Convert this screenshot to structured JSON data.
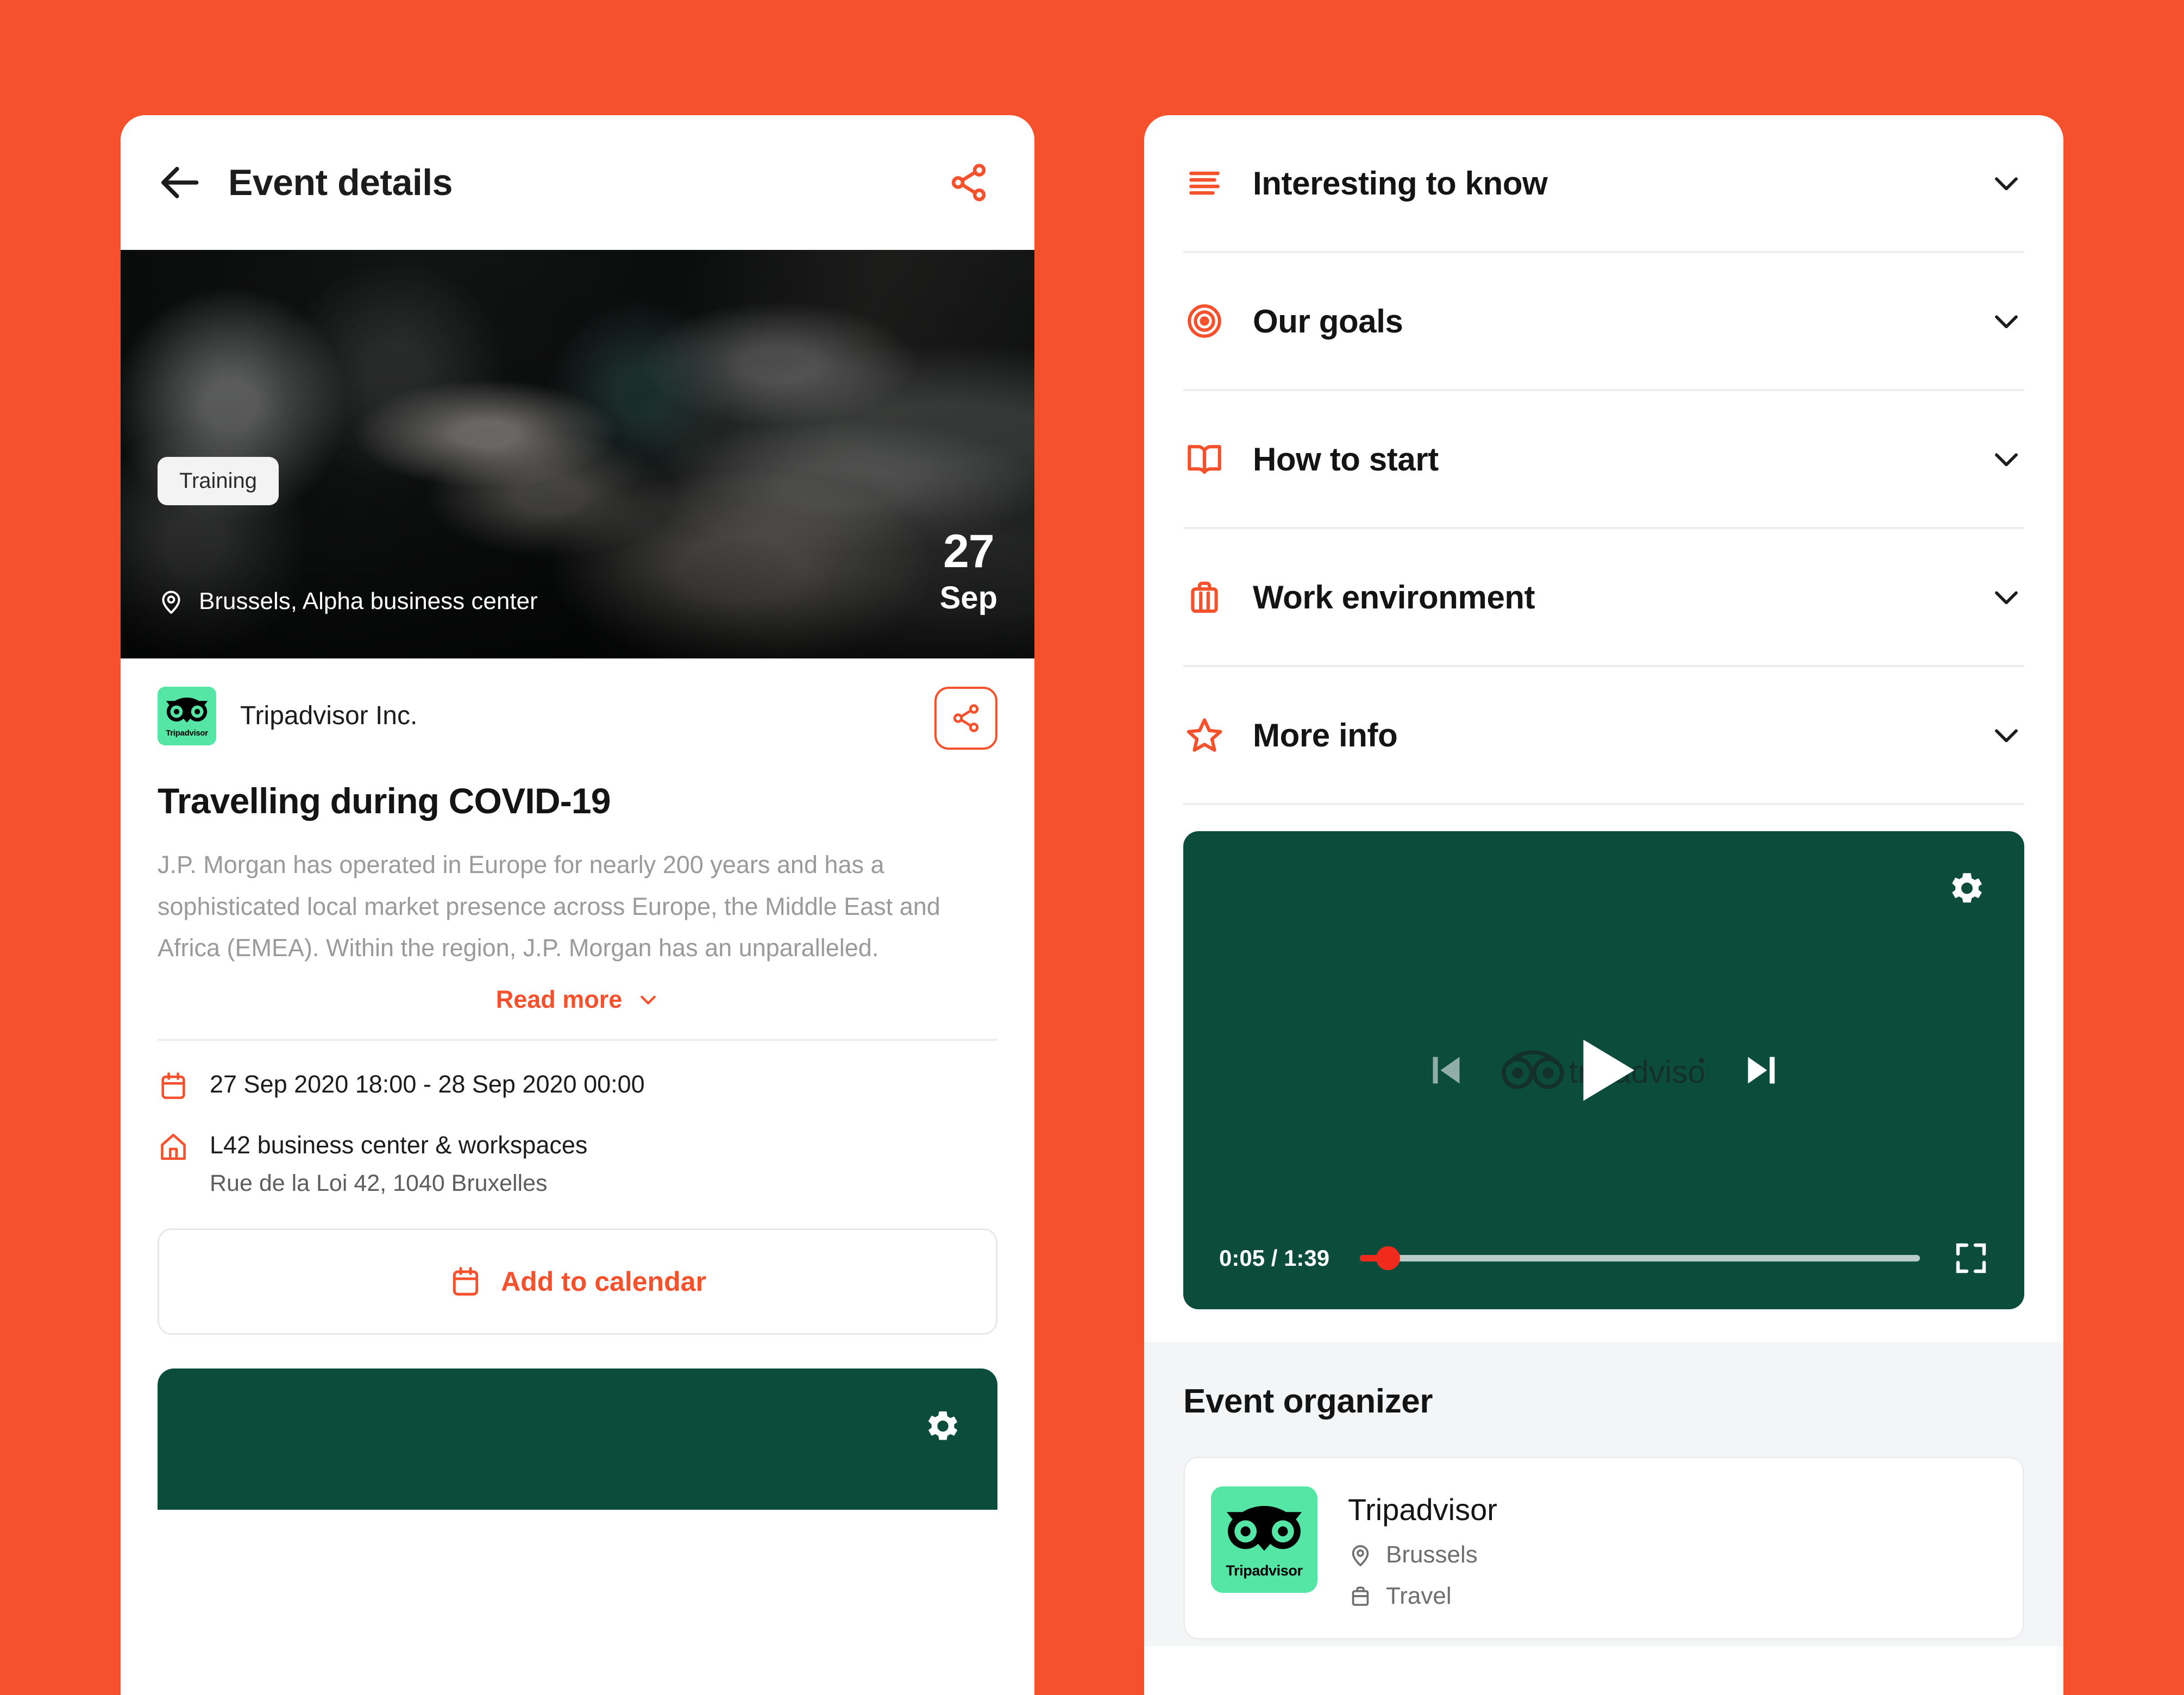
{
  "theme": {
    "accent": "#F4512C",
    "green_dark": "#0C4C3B",
    "tripadvisor_green": "#55E5A4",
    "progress_red": "#F02B1D"
  },
  "left_panel": {
    "header": {
      "back_icon": "arrow-left-icon",
      "title": "Event details",
      "share_icon": "share-icon"
    },
    "hero": {
      "badge": "Training",
      "location_icon": "map-pin-icon",
      "location": "Brussels, Alpha business center",
      "date_day": "27",
      "date_month": "Sep"
    },
    "organizer_row": {
      "logo_wordmark": "Tripadvisor",
      "name": "Tripadvisor Inc.",
      "share_icon": "share-icon"
    },
    "event": {
      "title": "Travelling during COVID-19",
      "description": "J.P. Morgan has operated in Europe for nearly 200 years and has a sophisticated local market presence across Europe, the Middle East and Africa (EMEA). Within the region, J.P. Morgan has an unparalleled.",
      "read_more_label": "Read more",
      "read_more_icon": "chevron-down-icon"
    },
    "meta": {
      "date_icon": "calendar-icon",
      "datetime": "27 Sep 2020 18:00 - 28 Sep 2020 00:00",
      "venue_icon": "home-icon",
      "venue_name": "L42 business center & workspaces",
      "venue_address": "Rue de la Loi 42, 1040 Bruxelles"
    },
    "add_to_calendar": {
      "icon": "calendar-icon",
      "label": "Add to calendar"
    },
    "video_preview": {
      "settings_icon": "gear-icon"
    }
  },
  "right_panel": {
    "accordion": [
      {
        "icon": "list-lines-icon",
        "label": "Interesting to know",
        "chevron": "chevron-down-icon",
        "expanded": false
      },
      {
        "icon": "target-icon",
        "label": "Our goals",
        "chevron": "chevron-down-icon",
        "expanded": false
      },
      {
        "icon": "open-book-icon",
        "label": "How to start",
        "chevron": "chevron-down-icon",
        "expanded": false
      },
      {
        "icon": "briefcase-icon",
        "label": "Work environment",
        "chevron": "chevron-down-icon",
        "expanded": false
      },
      {
        "icon": "star-icon",
        "label": "More info",
        "chevron": "chevron-down-icon",
        "expanded": false
      }
    ],
    "player": {
      "settings_icon": "gear-icon",
      "prev_icon": "skip-previous-icon",
      "play_icon": "play-icon",
      "next_icon": "skip-next-icon",
      "watermark": "tripadvisor",
      "current_time": "0:05",
      "total_time": "1:39",
      "time_display": "0:05 / 1:39",
      "progress_percent": 5,
      "fullscreen_icon": "fullscreen-icon"
    },
    "organizer_section": {
      "heading": "Event organizer",
      "card": {
        "logo_wordmark": "Tripadvisor",
        "name": "Tripadvisor",
        "location_icon": "map-pin-icon",
        "location": "Brussels",
        "category_icon": "briefcase-icon",
        "category": "Travel"
      }
    }
  }
}
